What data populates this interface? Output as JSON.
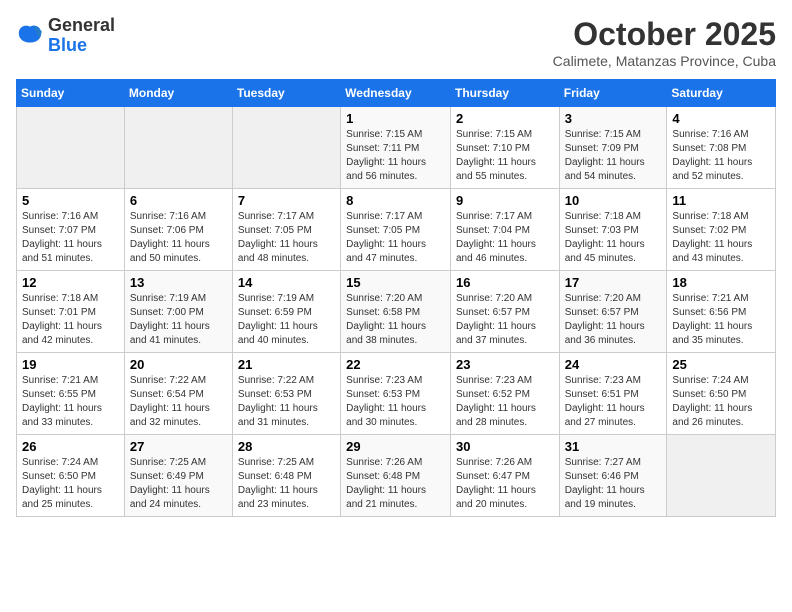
{
  "logo": {
    "general": "General",
    "blue": "Blue"
  },
  "header": {
    "month": "October 2025",
    "location": "Calimete, Matanzas Province, Cuba"
  },
  "days_of_week": [
    "Sunday",
    "Monday",
    "Tuesday",
    "Wednesday",
    "Thursday",
    "Friday",
    "Saturday"
  ],
  "weeks": [
    [
      {
        "day": "",
        "empty": true
      },
      {
        "day": "",
        "empty": true
      },
      {
        "day": "",
        "empty": true
      },
      {
        "day": "1",
        "sunrise": "7:15 AM",
        "sunset": "7:11 PM",
        "daylight": "11 hours and 56 minutes."
      },
      {
        "day": "2",
        "sunrise": "7:15 AM",
        "sunset": "7:10 PM",
        "daylight": "11 hours and 55 minutes."
      },
      {
        "day": "3",
        "sunrise": "7:15 AM",
        "sunset": "7:09 PM",
        "daylight": "11 hours and 54 minutes."
      },
      {
        "day": "4",
        "sunrise": "7:16 AM",
        "sunset": "7:08 PM",
        "daylight": "11 hours and 52 minutes."
      }
    ],
    [
      {
        "day": "5",
        "sunrise": "7:16 AM",
        "sunset": "7:07 PM",
        "daylight": "11 hours and 51 minutes."
      },
      {
        "day": "6",
        "sunrise": "7:16 AM",
        "sunset": "7:06 PM",
        "daylight": "11 hours and 50 minutes."
      },
      {
        "day": "7",
        "sunrise": "7:17 AM",
        "sunset": "7:05 PM",
        "daylight": "11 hours and 48 minutes."
      },
      {
        "day": "8",
        "sunrise": "7:17 AM",
        "sunset": "7:05 PM",
        "daylight": "11 hours and 47 minutes."
      },
      {
        "day": "9",
        "sunrise": "7:17 AM",
        "sunset": "7:04 PM",
        "daylight": "11 hours and 46 minutes."
      },
      {
        "day": "10",
        "sunrise": "7:18 AM",
        "sunset": "7:03 PM",
        "daylight": "11 hours and 45 minutes."
      },
      {
        "day": "11",
        "sunrise": "7:18 AM",
        "sunset": "7:02 PM",
        "daylight": "11 hours and 43 minutes."
      }
    ],
    [
      {
        "day": "12",
        "sunrise": "7:18 AM",
        "sunset": "7:01 PM",
        "daylight": "11 hours and 42 minutes."
      },
      {
        "day": "13",
        "sunrise": "7:19 AM",
        "sunset": "7:00 PM",
        "daylight": "11 hours and 41 minutes."
      },
      {
        "day": "14",
        "sunrise": "7:19 AM",
        "sunset": "6:59 PM",
        "daylight": "11 hours and 40 minutes."
      },
      {
        "day": "15",
        "sunrise": "7:20 AM",
        "sunset": "6:58 PM",
        "daylight": "11 hours and 38 minutes."
      },
      {
        "day": "16",
        "sunrise": "7:20 AM",
        "sunset": "6:57 PM",
        "daylight": "11 hours and 37 minutes."
      },
      {
        "day": "17",
        "sunrise": "7:20 AM",
        "sunset": "6:57 PM",
        "daylight": "11 hours and 36 minutes."
      },
      {
        "day": "18",
        "sunrise": "7:21 AM",
        "sunset": "6:56 PM",
        "daylight": "11 hours and 35 minutes."
      }
    ],
    [
      {
        "day": "19",
        "sunrise": "7:21 AM",
        "sunset": "6:55 PM",
        "daylight": "11 hours and 33 minutes."
      },
      {
        "day": "20",
        "sunrise": "7:22 AM",
        "sunset": "6:54 PM",
        "daylight": "11 hours and 32 minutes."
      },
      {
        "day": "21",
        "sunrise": "7:22 AM",
        "sunset": "6:53 PM",
        "daylight": "11 hours and 31 minutes."
      },
      {
        "day": "22",
        "sunrise": "7:23 AM",
        "sunset": "6:53 PM",
        "daylight": "11 hours and 30 minutes."
      },
      {
        "day": "23",
        "sunrise": "7:23 AM",
        "sunset": "6:52 PM",
        "daylight": "11 hours and 28 minutes."
      },
      {
        "day": "24",
        "sunrise": "7:23 AM",
        "sunset": "6:51 PM",
        "daylight": "11 hours and 27 minutes."
      },
      {
        "day": "25",
        "sunrise": "7:24 AM",
        "sunset": "6:50 PM",
        "daylight": "11 hours and 26 minutes."
      }
    ],
    [
      {
        "day": "26",
        "sunrise": "7:24 AM",
        "sunset": "6:50 PM",
        "daylight": "11 hours and 25 minutes."
      },
      {
        "day": "27",
        "sunrise": "7:25 AM",
        "sunset": "6:49 PM",
        "daylight": "11 hours and 24 minutes."
      },
      {
        "day": "28",
        "sunrise": "7:25 AM",
        "sunset": "6:48 PM",
        "daylight": "11 hours and 23 minutes."
      },
      {
        "day": "29",
        "sunrise": "7:26 AM",
        "sunset": "6:48 PM",
        "daylight": "11 hours and 21 minutes."
      },
      {
        "day": "30",
        "sunrise": "7:26 AM",
        "sunset": "6:47 PM",
        "daylight": "11 hours and 20 minutes."
      },
      {
        "day": "31",
        "sunrise": "7:27 AM",
        "sunset": "6:46 PM",
        "daylight": "11 hours and 19 minutes."
      },
      {
        "day": "",
        "empty": true
      }
    ]
  ],
  "labels": {
    "sunrise": "Sunrise:",
    "sunset": "Sunset:",
    "daylight": "Daylight:"
  }
}
